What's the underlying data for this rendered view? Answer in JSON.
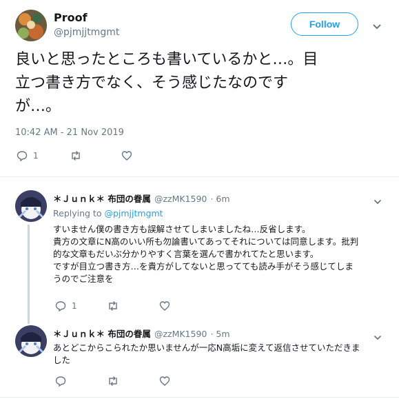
{
  "main_tweet": {
    "name": "Proof",
    "handle": "@pjmjjtmgmt",
    "follow_label": "Follow",
    "text": "良いと思ったところも書いているかと…。目\n立つ書き方でなく、そう感じたなのです\nが…。",
    "timestamp": "10:42 AM - 21 Nov 2019",
    "reply_count": "1"
  },
  "replies": [
    {
      "name": "＊Ｊｕｎｋ＊ 布団の眷属",
      "handle": "@zzMK1590",
      "time": "· 6m",
      "replying_prefix": "Replying to",
      "replying_to": "@pjmjjtmgmt",
      "text": "すいません僕の書き方も誤解させてしまいましたね…反省します。\n貴方の文章にN高のいい所も勿論書いてあってそれについては同意します。批判\n的な文章もだいぶ分かりやすく言葉を選んで書かれてたと思います。\nですが目立つ書き方…を貴方がしてないと思ってても読み手がそう感じてしま\nうのでご注意を",
      "reply_count": "1"
    },
    {
      "name": "＊Ｊｕｎｋ＊ 布団の眷属",
      "handle": "@zzMK1590",
      "time": "· 5m",
      "text": "あとどこからこられたか思いませんが一応N高垢に変えて返信させていただきま\nした"
    }
  ]
}
